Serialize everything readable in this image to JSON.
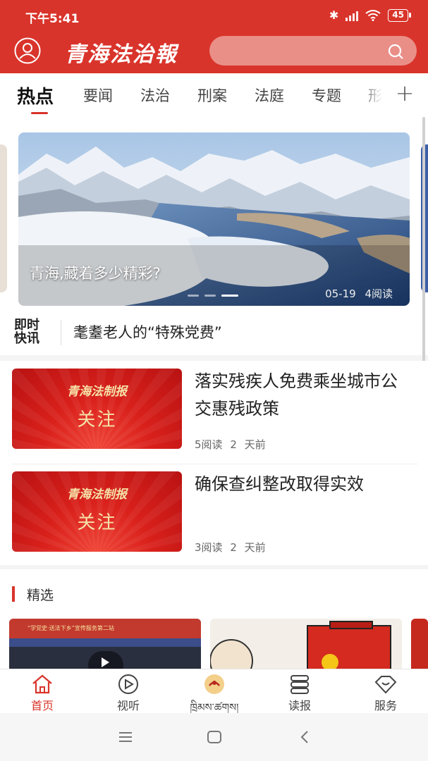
{
  "status": {
    "time": "下午5:41",
    "battery": "45"
  },
  "header": {
    "logo": "青海法治報",
    "search_placeholder": ""
  },
  "tabs": [
    "热点",
    "要闻",
    "法治",
    "刑案",
    "法庭",
    "专题",
    "形"
  ],
  "tab_plus": "+",
  "banner": {
    "title": "青海,藏着多少精彩?",
    "date": "05-19",
    "reads": "4阅读"
  },
  "flash": {
    "badge_line1": "即时",
    "badge_line2": "快讯",
    "text": "耄耋老人的“特殊党费”"
  },
  "news": [
    {
      "title": "落实残疾人免费乘坐城市公交惠残政策",
      "reads": "5阅读",
      "time": "2 天前",
      "thumb_brand": "青海法制报",
      "thumb_text": "关注"
    },
    {
      "title": "确保查纠整改取得实效",
      "reads": "3阅读",
      "time": "2 天前",
      "thumb_brand": "青海法制报",
      "thumb_text": "关注"
    }
  ],
  "featured": {
    "label": "精选",
    "video_caption": "“学党史·送法下乡”宣传服务第二站"
  },
  "bottom_nav": [
    {
      "label": "首页",
      "icon": "home-icon"
    },
    {
      "label": "视听",
      "icon": "play-icon"
    },
    {
      "label": "ཁྲིམས་ཚགས།",
      "icon": "emblem-icon"
    },
    {
      "label": "读报",
      "icon": "newspaper-icon"
    },
    {
      "label": "服务",
      "icon": "service-icon"
    }
  ],
  "colors": {
    "brand_red": "#d9342b",
    "search_bg": "#e98f88"
  }
}
